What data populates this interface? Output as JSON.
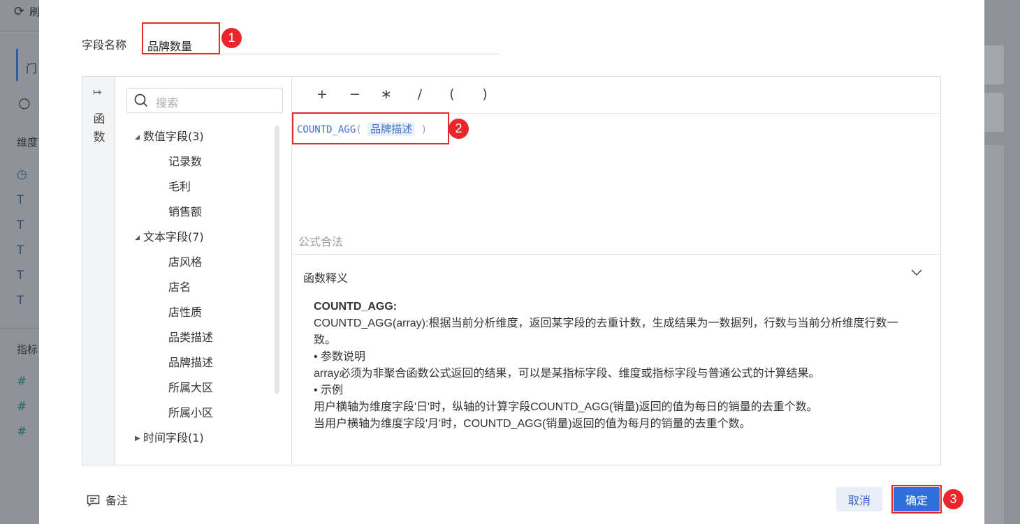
{
  "background": {
    "left_items": [
      "刷",
      "门",
      "维度",
      "指标"
    ],
    "left_icons": [
      "clock-icon",
      "text-type-icon",
      "hash-icon"
    ]
  },
  "dialog": {
    "field_name_label": "字段名称",
    "field_name_value": "品牌数量",
    "rail_label": "函数",
    "search_placeholder": "搜索",
    "field_groups": [
      {
        "label": "数值字段(3)",
        "expanded": true,
        "items": [
          "记录数",
          "毛利",
          "销售额"
        ]
      },
      {
        "label": "文本字段(7)",
        "expanded": true,
        "items": [
          "店风格",
          "店名",
          "店性质",
          "品类描述",
          "品牌描述",
          "所属大区",
          "所属小区"
        ]
      },
      {
        "label": "时间字段(1)",
        "expanded": false,
        "items": []
      }
    ],
    "operators": [
      "+",
      "−",
      "∗",
      "/",
      "(",
      ")"
    ],
    "formula": {
      "function": "COUNTD_AGG",
      "open": "(",
      "field": "品牌描述",
      "close": ")"
    },
    "validation_text": "公式合法",
    "explain_title": "函数释义",
    "explain": {
      "name": "COUNTD_AGG:",
      "lines": [
        "COUNTD_AGG(array):根据当前分析维度，返回某字段的去重计数，生成结果为一数据列，行数与当前分析维度行数一致。",
        "• 参数说明",
        "array必须为非聚合函数公式返回的结果，可以是某指标字段、维度或指标字段与普通公式的计算结果。",
        "• 示例",
        "用户横轴为维度字段'日'时，纵轴的计算字段COUNTD_AGG(销量)返回的值为每日的销量的去重个数。",
        "当用户横轴为维度字段'月'时，COUNTD_AGG(销量)返回的值为每月的销量的去重个数。"
      ]
    },
    "note_label": "备注",
    "cancel_label": "取消",
    "ok_label": "确定"
  },
  "annotations": [
    "1",
    "2",
    "3"
  ],
  "colors": {
    "accent": "#2f6fd9",
    "highlight": "#e02c2c",
    "formula": "#3c72c9"
  }
}
